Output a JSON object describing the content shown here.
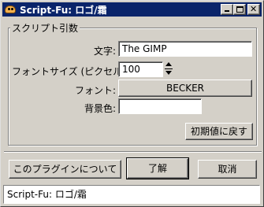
{
  "window": {
    "title": "Script-Fu: ロゴ/霜",
    "icon": "gimp-fox-icon"
  },
  "frame": {
    "legend": "スクリプト引数"
  },
  "fields": {
    "text_label": "文字:",
    "text_value": "The GIMP",
    "size_label": "フォントサイズ (ピクセル):",
    "size_value": "100",
    "font_label": "フォント:",
    "font_value": "BECKER",
    "bg_label": "背景色:",
    "bg_color": "#ffffff"
  },
  "buttons": {
    "reset": "初期値に戻す",
    "about": "このプラグインについて",
    "ok": "了解",
    "cancel": "取消"
  },
  "status": {
    "text": "Script-Fu: ロゴ/霜"
  }
}
